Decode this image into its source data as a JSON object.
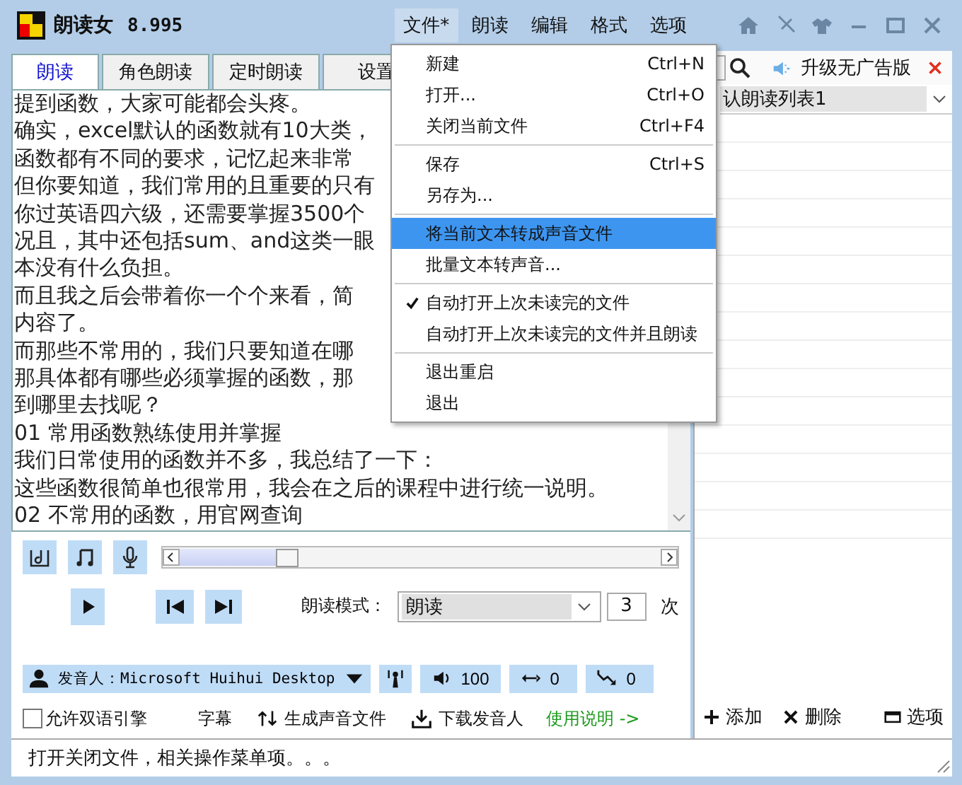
{
  "window": {
    "title": "朗读女",
    "version": "8.995"
  },
  "menu_bar": [
    {
      "label": "文件*",
      "selected": true
    },
    {
      "label": "朗读",
      "selected": false
    },
    {
      "label": "编辑",
      "selected": false
    },
    {
      "label": "格式",
      "selected": false
    },
    {
      "label": "选项",
      "selected": false
    }
  ],
  "tabs": [
    {
      "label": "朗读",
      "selected": true
    },
    {
      "label": "角色朗读",
      "selected": false
    },
    {
      "label": "定时朗读",
      "selected": false
    },
    {
      "label": "设置",
      "selected": false
    }
  ],
  "editor": {
    "lines": [
      "提到函数，大家可能都会头疼。",
      "确实，excel默认的函数就有10大类，",
      "函数都有不同的要求，记忆起来非常",
      "但你要知道，我们常用的且重要的只有",
      "你过英语四六级，还需要掌握3500个",
      "况且，其中还包括sum、and这类一眼",
      "本没有什么负担。",
      "而且我之后会带着你一个个来看，简",
      "内容了。",
      "而那些不常用的，我们只要知道在哪",
      "那具体都有哪些必须掌握的函数，那",
      "到哪里去找呢？",
      "01 常用函数熟练使用并掌握",
      "我们日常使用的函数并不多，我总结了一下：",
      "这些函数很简单也很常用，我会在之后的课程中进行统一说明。",
      "02 不常用的函数，用官网查询"
    ]
  },
  "file_menu": {
    "items": [
      {
        "kind": "item",
        "label": "新建",
        "shortcut": "Ctrl+N",
        "checked": false,
        "selected": false
      },
      {
        "kind": "item",
        "label": "打开...",
        "shortcut": "Ctrl+O",
        "checked": false,
        "selected": false
      },
      {
        "kind": "item",
        "label": "关闭当前文件",
        "shortcut": "Ctrl+F4",
        "checked": false,
        "selected": false
      },
      {
        "kind": "separator"
      },
      {
        "kind": "item",
        "label": "保存",
        "shortcut": "Ctrl+S",
        "checked": false,
        "selected": false
      },
      {
        "kind": "item",
        "label": "另存为...",
        "checked": false,
        "selected": false
      },
      {
        "kind": "separator"
      },
      {
        "kind": "item",
        "label": "将当前文本转成声音文件",
        "checked": false,
        "selected": true
      },
      {
        "kind": "item",
        "label": "批量文本转声音...",
        "checked": false,
        "selected": false
      },
      {
        "kind": "separator"
      },
      {
        "kind": "item",
        "label": "自动打开上次未读完的文件",
        "checked": true,
        "selected": false
      },
      {
        "kind": "item",
        "label": "自动打开上次未读完的文件并且朗读",
        "checked": false,
        "selected": false
      },
      {
        "kind": "separator"
      },
      {
        "kind": "item",
        "label": "退出重启",
        "checked": false,
        "selected": false
      },
      {
        "kind": "item",
        "label": "退出",
        "checked": false,
        "selected": false
      }
    ]
  },
  "right_panel": {
    "upgrade": "升级无广告版",
    "playlist": "认朗读列表1",
    "actions": [
      "添加",
      "删除",
      "选项"
    ]
  },
  "player": {
    "progress": {
      "level": 0.22
    },
    "mode_label": "朗读模式：",
    "mode_value": "朗读",
    "repeat": "3",
    "repeat_unit": "次"
  },
  "voice": {
    "label": "发音人：Microsoft Huihui Desktop",
    "volume": "100",
    "speed": "0",
    "pitch": "0"
  },
  "options": {
    "bilingual": {
      "label": "允许双语引擎",
      "checked": false
    },
    "subtitle": "字幕",
    "generate": "生成声音文件",
    "download": "下载发音人",
    "help": "使用说明 ->"
  },
  "status_bar": "打开关闭文件，相关操作菜单项。。。"
}
